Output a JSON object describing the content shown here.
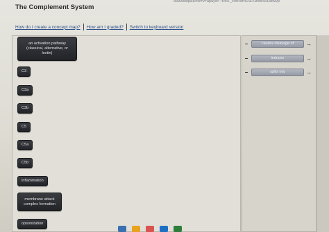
{
  "browser": {
    "url_fragment": "0000000paiche=Vrapayer-tool_content23C+Bonk%3Ceb92p"
  },
  "page": {
    "title": "The Complement System"
  },
  "links": [
    {
      "label": "How do I create a concept map?"
    },
    {
      "label": "How am I graded?"
    },
    {
      "label": "Switch to keyboard version"
    }
  ],
  "concepts": {
    "lead": "an activation pathway (classical, alternative, or lectin)",
    "items": [
      {
        "label": "C3"
      },
      {
        "label": "C3a"
      },
      {
        "label": "C3b"
      },
      {
        "label": "C5"
      },
      {
        "label": "C5a"
      },
      {
        "label": "C5b"
      },
      {
        "label": "inflammation"
      },
      {
        "label": "membrane attack complex formation"
      },
      {
        "label": "opsonization"
      }
    ]
  },
  "link_labels": [
    {
      "label": "causes cleavage of"
    },
    {
      "label": "induces"
    },
    {
      "label": "splits into"
    }
  ],
  "icons": {
    "remove": "minus-icon",
    "connect": "arrow-right-icon"
  },
  "glyphs": {
    "minus": "−",
    "arrow": "→"
  },
  "taskbar_icon_colors": [
    "#3a6fb0",
    "#e8a21b",
    "#d9534f",
    "#1d6fc4",
    "#2f7d3a"
  ]
}
